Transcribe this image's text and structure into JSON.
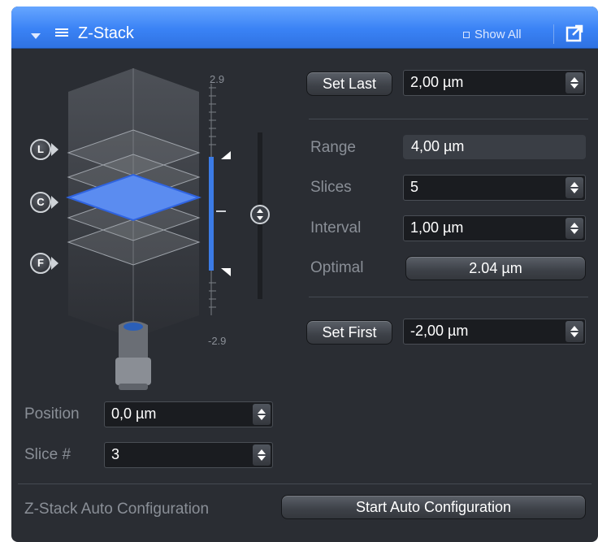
{
  "header": {
    "title": "Z-Stack",
    "show_all": "Show All"
  },
  "scale": {
    "top": "2.9",
    "bottom": "-2.9"
  },
  "markers": {
    "last": "L",
    "center": "C",
    "first": "F"
  },
  "set_last": {
    "label": "Set Last",
    "value": "2,00 µm"
  },
  "range": {
    "label": "Range",
    "value": "4,00 µm"
  },
  "slices": {
    "label": "Slices",
    "value": "5"
  },
  "interval": {
    "label": "Interval",
    "value": "1,00 µm"
  },
  "optimal": {
    "label": "Optimal",
    "value": "2.04 µm"
  },
  "set_first": {
    "label": "Set First",
    "value": "-2,00 µm"
  },
  "position": {
    "label": "Position",
    "value": "0,0 µm"
  },
  "slice_num": {
    "label": "Slice #",
    "value": "3"
  },
  "auto_config": {
    "label": "Z-Stack Auto Configuration",
    "button": "Start Auto Configuration"
  },
  "colors": {
    "accent": "#3a82f5",
    "background": "#2a2d33",
    "selected_slice": "#5b8cf0"
  }
}
